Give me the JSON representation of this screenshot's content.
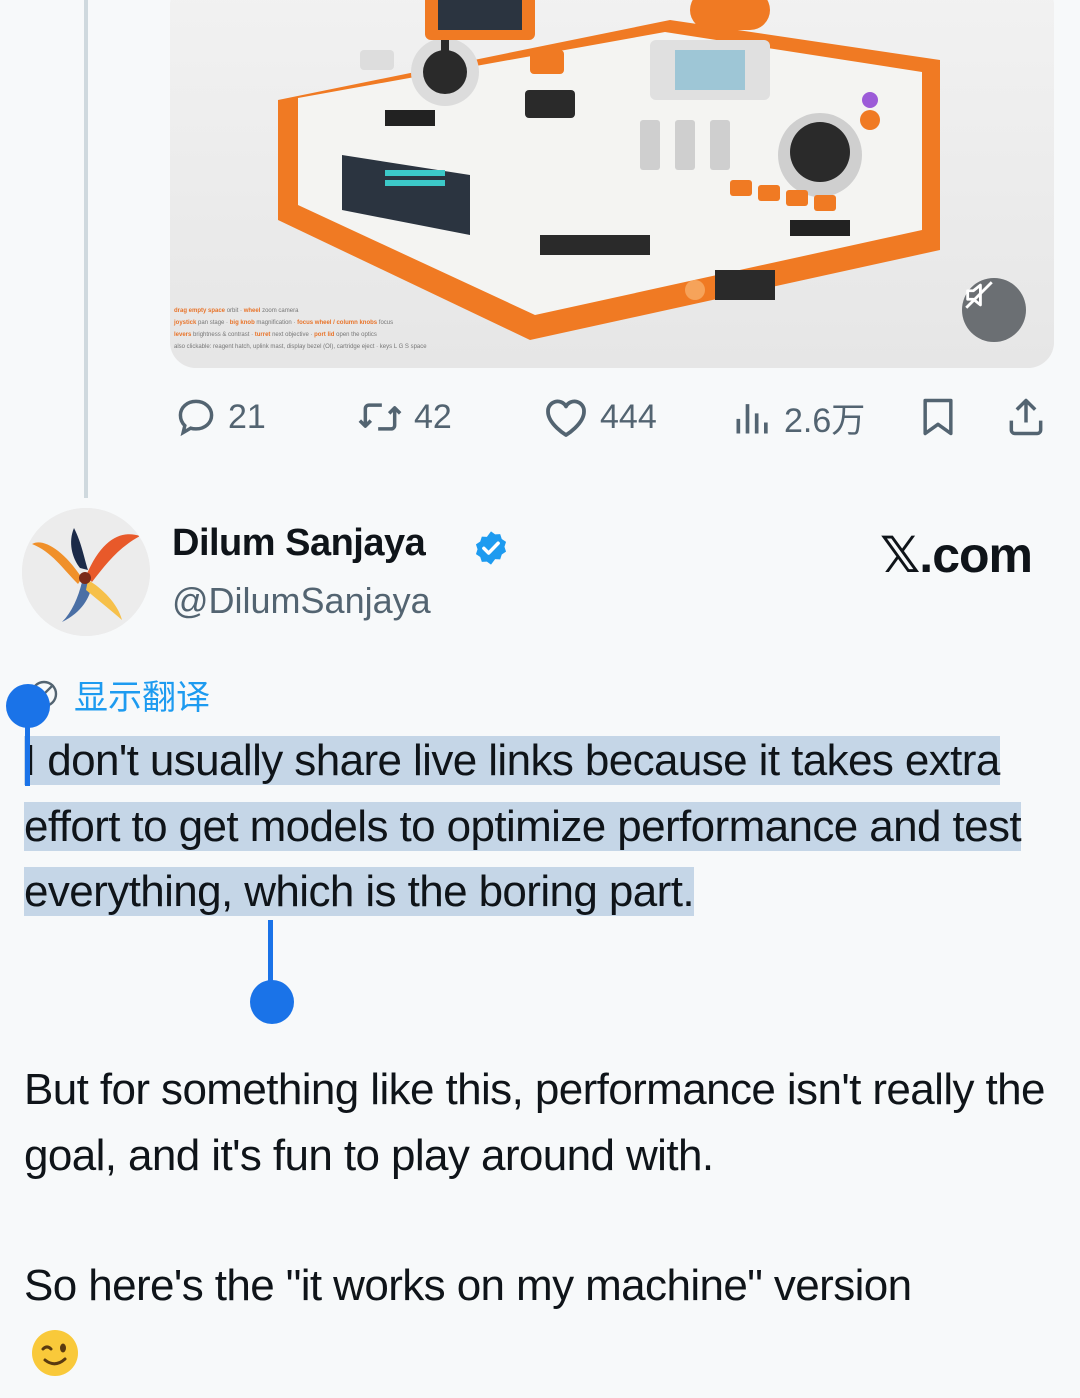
{
  "media": {
    "hints": [
      {
        "key": "drag empty space",
        "desc": "orbit",
        "key2": "wheel",
        "desc2": "zoom camera"
      },
      {
        "key": "joystick",
        "desc": "pan stage",
        "key2": "big knob",
        "desc2": "magnification",
        "key3": "focus wheel / column knobs",
        "desc3": "focus"
      },
      {
        "key": "levers",
        "desc": "brightness & contrast",
        "key2": "turret",
        "desc2": "next objective",
        "key3": "port lid",
        "desc3": "open the optics"
      },
      {
        "key": "",
        "desc": "also clickable: reagent hatch, uplink mast, display bezel (OI), cartridge eject",
        "key2": "keys",
        "desc2": "L G S space"
      }
    ],
    "mute_icon": "muted-speaker-icon"
  },
  "actions": {
    "reply": {
      "icon": "reply-icon",
      "count": "21"
    },
    "repost": {
      "icon": "repost-icon",
      "count": "42"
    },
    "like": {
      "icon": "heart-icon",
      "count": "444"
    },
    "views": {
      "icon": "views-chart-icon",
      "count": "2.6万"
    },
    "bookmark": {
      "icon": "bookmark-icon"
    },
    "share": {
      "icon": "share-icon"
    }
  },
  "author": {
    "name": "Dilum Sanjaya",
    "handle": "@DilumSanjaya",
    "verified": true
  },
  "brand": "𝕏.com",
  "translate_label": "显示翻译",
  "tweet": {
    "paragraph1": "I don't usually share live links because it takes extra effort to get models to optimize performance and test everything, which is the boring part.",
    "paragraph2": "But for something like this, performance isn't really the goal, and it's fun to play around with.",
    "paragraph3": "So here's the \"it works on my machine\" version",
    "emoji": "winking-face-emoji"
  },
  "colors": {
    "accent": "#1d9bf0",
    "selection": "#c5d6e7",
    "selection_handle": "#1a73e8",
    "muted": "#536471",
    "device_orange": "#f07a23"
  }
}
